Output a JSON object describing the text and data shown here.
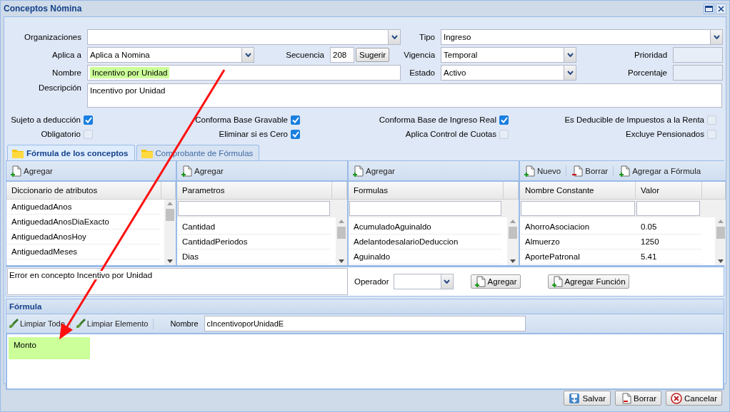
{
  "window": {
    "title": "Conceptos Nómina"
  },
  "form": {
    "organizaciones": {
      "label": "Organizaciones"
    },
    "tipo": {
      "label": "Tipo",
      "value": "Ingreso"
    },
    "aplica_a": {
      "label": "Aplica a",
      "value": "Aplica a Nomina"
    },
    "secuencia": {
      "label": "Secuencia",
      "value": "208",
      "button": "Sugerir"
    },
    "vigencia": {
      "label": "Vigencia",
      "value": "Temporal"
    },
    "prioridad": {
      "label": "Prioridad"
    },
    "nombre": {
      "label": "Nombre",
      "value": "Incentivo por Unidad",
      "highlighted": true
    },
    "estado": {
      "label": "Estado",
      "value": "Activo"
    },
    "porcentaje": {
      "label": "Porcentaje"
    },
    "descripcion": {
      "label": "Descripción",
      "value": "Incentivo por Unidad"
    }
  },
  "checkboxes": [
    {
      "label": "Sujeto a deducción",
      "checked": true
    },
    {
      "label": "Conforma Base Gravable",
      "checked": true
    },
    {
      "label": "Conforma Base de Ingreso Real",
      "checked": true
    },
    {
      "label": "Es Deducible de Impuestos a la Renta",
      "checked": false
    },
    {
      "label": "Obligatorio",
      "checked": false
    },
    {
      "label": "Eliminar si es Cero",
      "checked": true
    },
    {
      "label": "Aplica Control de Cuotas",
      "checked": false
    },
    {
      "label": "Excluye Pensionados",
      "checked": false
    }
  ],
  "tabs": [
    {
      "label": "Fórmula de los conceptos",
      "selected": true
    },
    {
      "label": "Comprobante de Fórmulas",
      "selected": false
    }
  ],
  "panels": [
    {
      "toolbar": [
        {
          "label": "Agregar",
          "kind": "add"
        }
      ],
      "columns": [
        "Diccionario de atributos"
      ],
      "has_filter": false,
      "rows": [
        [
          "AntiguedadAnos"
        ],
        [
          "AntiguedadAnosDiaExacto"
        ],
        [
          "AntiguedadAnosHoy"
        ],
        [
          "AntiguedadMeses"
        ]
      ]
    },
    {
      "toolbar": [
        {
          "label": "Agregar",
          "kind": "add"
        }
      ],
      "columns": [
        "Parametros"
      ],
      "has_filter": true,
      "rows": [
        [
          "Cantidad"
        ],
        [
          "CantidadPeriodos"
        ],
        [
          "Dias"
        ]
      ]
    },
    {
      "toolbar": [
        {
          "label": "Agregar",
          "kind": "add"
        }
      ],
      "columns": [
        "Formulas"
      ],
      "has_filter": true,
      "rows": [
        [
          "AcumuladoAguinaldo"
        ],
        [
          "AdelantodesalarioDeduccion"
        ],
        [
          "Aguinaldo"
        ]
      ]
    },
    {
      "toolbar": [
        {
          "label": "Nuevo",
          "kind": "add"
        },
        {
          "label": "Borrar",
          "kind": "remove"
        },
        {
          "label": "Agregar a Fórmula",
          "kind": "add"
        }
      ],
      "columns": [
        "Nombre Constante",
        "Valor"
      ],
      "has_filter": true,
      "rows": [
        [
          "AhorroAsociacion",
          "0.05"
        ],
        [
          "Almuerzo",
          "1250"
        ],
        [
          "AportePatronal",
          "5.41"
        ]
      ]
    }
  ],
  "message": "Error en concepto Incentivo por Unidad",
  "operator": {
    "label": "Operador",
    "add_button": "Agregar",
    "function_button": "Agregar Función"
  },
  "formula": {
    "title": "Fórmula",
    "tools": [
      {
        "label": "Limpiar Todo"
      },
      {
        "label": "Limpiar Elemento"
      }
    ],
    "name_label": "Nombre",
    "name_value": "cIncentivoporUnidadE",
    "elements": [
      {
        "text": "Monto",
        "highlighted": true
      }
    ]
  },
  "buttons": [
    {
      "label": "Salvar",
      "kind": "save"
    },
    {
      "label": "Borrar",
      "kind": "delete"
    },
    {
      "label": "Cancelar",
      "kind": "cancel"
    }
  ]
}
